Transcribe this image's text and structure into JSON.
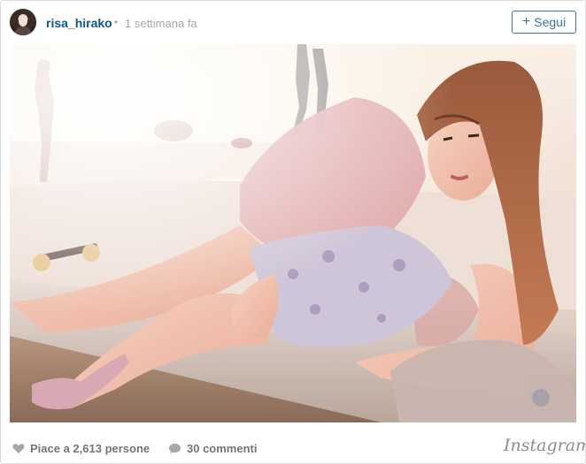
{
  "post": {
    "username": "risa_hirako",
    "separator": "•",
    "timestamp": "1 settimana fa",
    "follow_label": "Segui",
    "likes_text": "Piace a 2,613 persone",
    "comments_text": "30 commenti",
    "brand": "Instagram"
  },
  "colors": {
    "username": "#125688",
    "follow_border": "#3f729b",
    "meta_text": "#70757a",
    "muted": "#a5a7aa"
  },
  "icons": {
    "follow": "plus-icon",
    "likes": "heart-icon",
    "comments": "comment-icon"
  }
}
